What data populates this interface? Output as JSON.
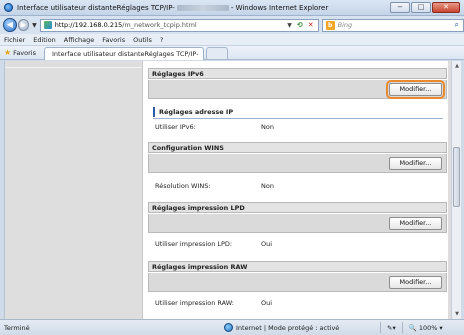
{
  "window": {
    "title_prefix": "Interface utilisateur distanteRéglages TCP/IP-",
    "title_suffix": "- Windows Internet Explorer",
    "min_label": "−",
    "max_label": "□",
    "close_label": "✕"
  },
  "address_bar": {
    "url_host": "http://192.168.0.215",
    "url_path": "/m_network_tcpip.html",
    "search_placeholder": "Bing"
  },
  "menu": {
    "items": [
      "Fichier",
      "Edition",
      "Affichage",
      "Favoris",
      "Outils",
      "?"
    ]
  },
  "favorites": {
    "label": "Favoris",
    "tab_title": "Interface utilisateur distanteRéglages TCP/IP-"
  },
  "sections": {
    "ipv6": {
      "header": "Réglages IPv6",
      "button": "Modifier...",
      "subheader": "Réglages adresse IP",
      "row_label": "Utiliser IPv6:",
      "row_value": "Non"
    },
    "wins": {
      "header": "Configuration WINS",
      "button": "Modifier...",
      "row_label": "Résolution WINS:",
      "row_value": "Non"
    },
    "lpd": {
      "header": "Réglages impression LPD",
      "button": "Modifier...",
      "row_label": "Utiliser impression LPD:",
      "row_value": "Oui"
    },
    "raw": {
      "header": "Réglages impression RAW",
      "button": "Modifier...",
      "row_label": "Utiliser impression RAW:",
      "row_value": "Oui"
    }
  },
  "status": {
    "left": "Terminé",
    "zone": "Internet | Mode protégé : activé",
    "zoom": "100%"
  },
  "colors": {
    "focus_outline": "#e98a2f",
    "subheader_bar": "#2b5cab"
  }
}
